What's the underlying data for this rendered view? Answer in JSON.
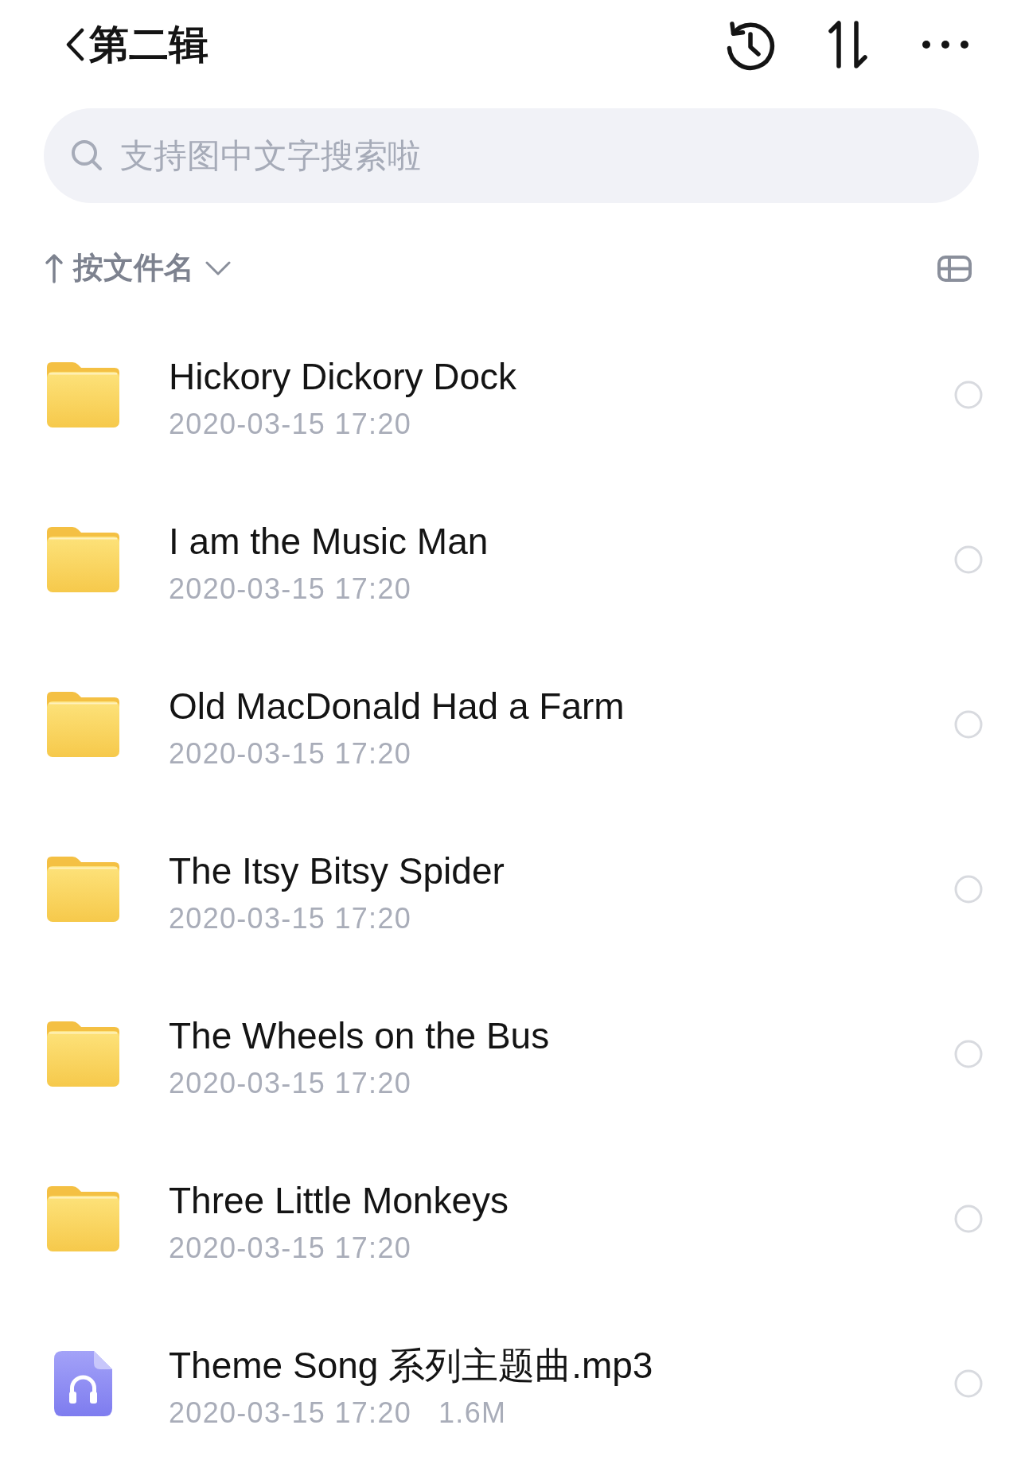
{
  "header": {
    "title": "第二辑"
  },
  "search": {
    "placeholder": "支持图中文字搜索啦"
  },
  "sort_bar": {
    "label": "按文件名"
  },
  "files": [
    {
      "kind": "folder",
      "name": "Hickory Dickory Dock",
      "modified": "2020-03-15 17:20",
      "selected": false
    },
    {
      "kind": "folder",
      "name": "I am the Music Man",
      "modified": "2020-03-15 17:20",
      "selected": false
    },
    {
      "kind": "folder",
      "name": "Old MacDonald Had a Farm",
      "modified": "2020-03-15 17:20",
      "selected": false
    },
    {
      "kind": "folder",
      "name": "The Itsy Bitsy Spider",
      "modified": "2020-03-15 17:20",
      "selected": false
    },
    {
      "kind": "folder",
      "name": "The Wheels on the Bus",
      "modified": "2020-03-15 17:20",
      "selected": false
    },
    {
      "kind": "folder",
      "name": "Three Little Monkeys",
      "modified": "2020-03-15 17:20",
      "selected": false
    },
    {
      "kind": "audio",
      "name": "Theme Song 系列主题曲.mp3",
      "modified": "2020-03-15 17:20",
      "size": "1.6M",
      "selected": false
    }
  ]
}
